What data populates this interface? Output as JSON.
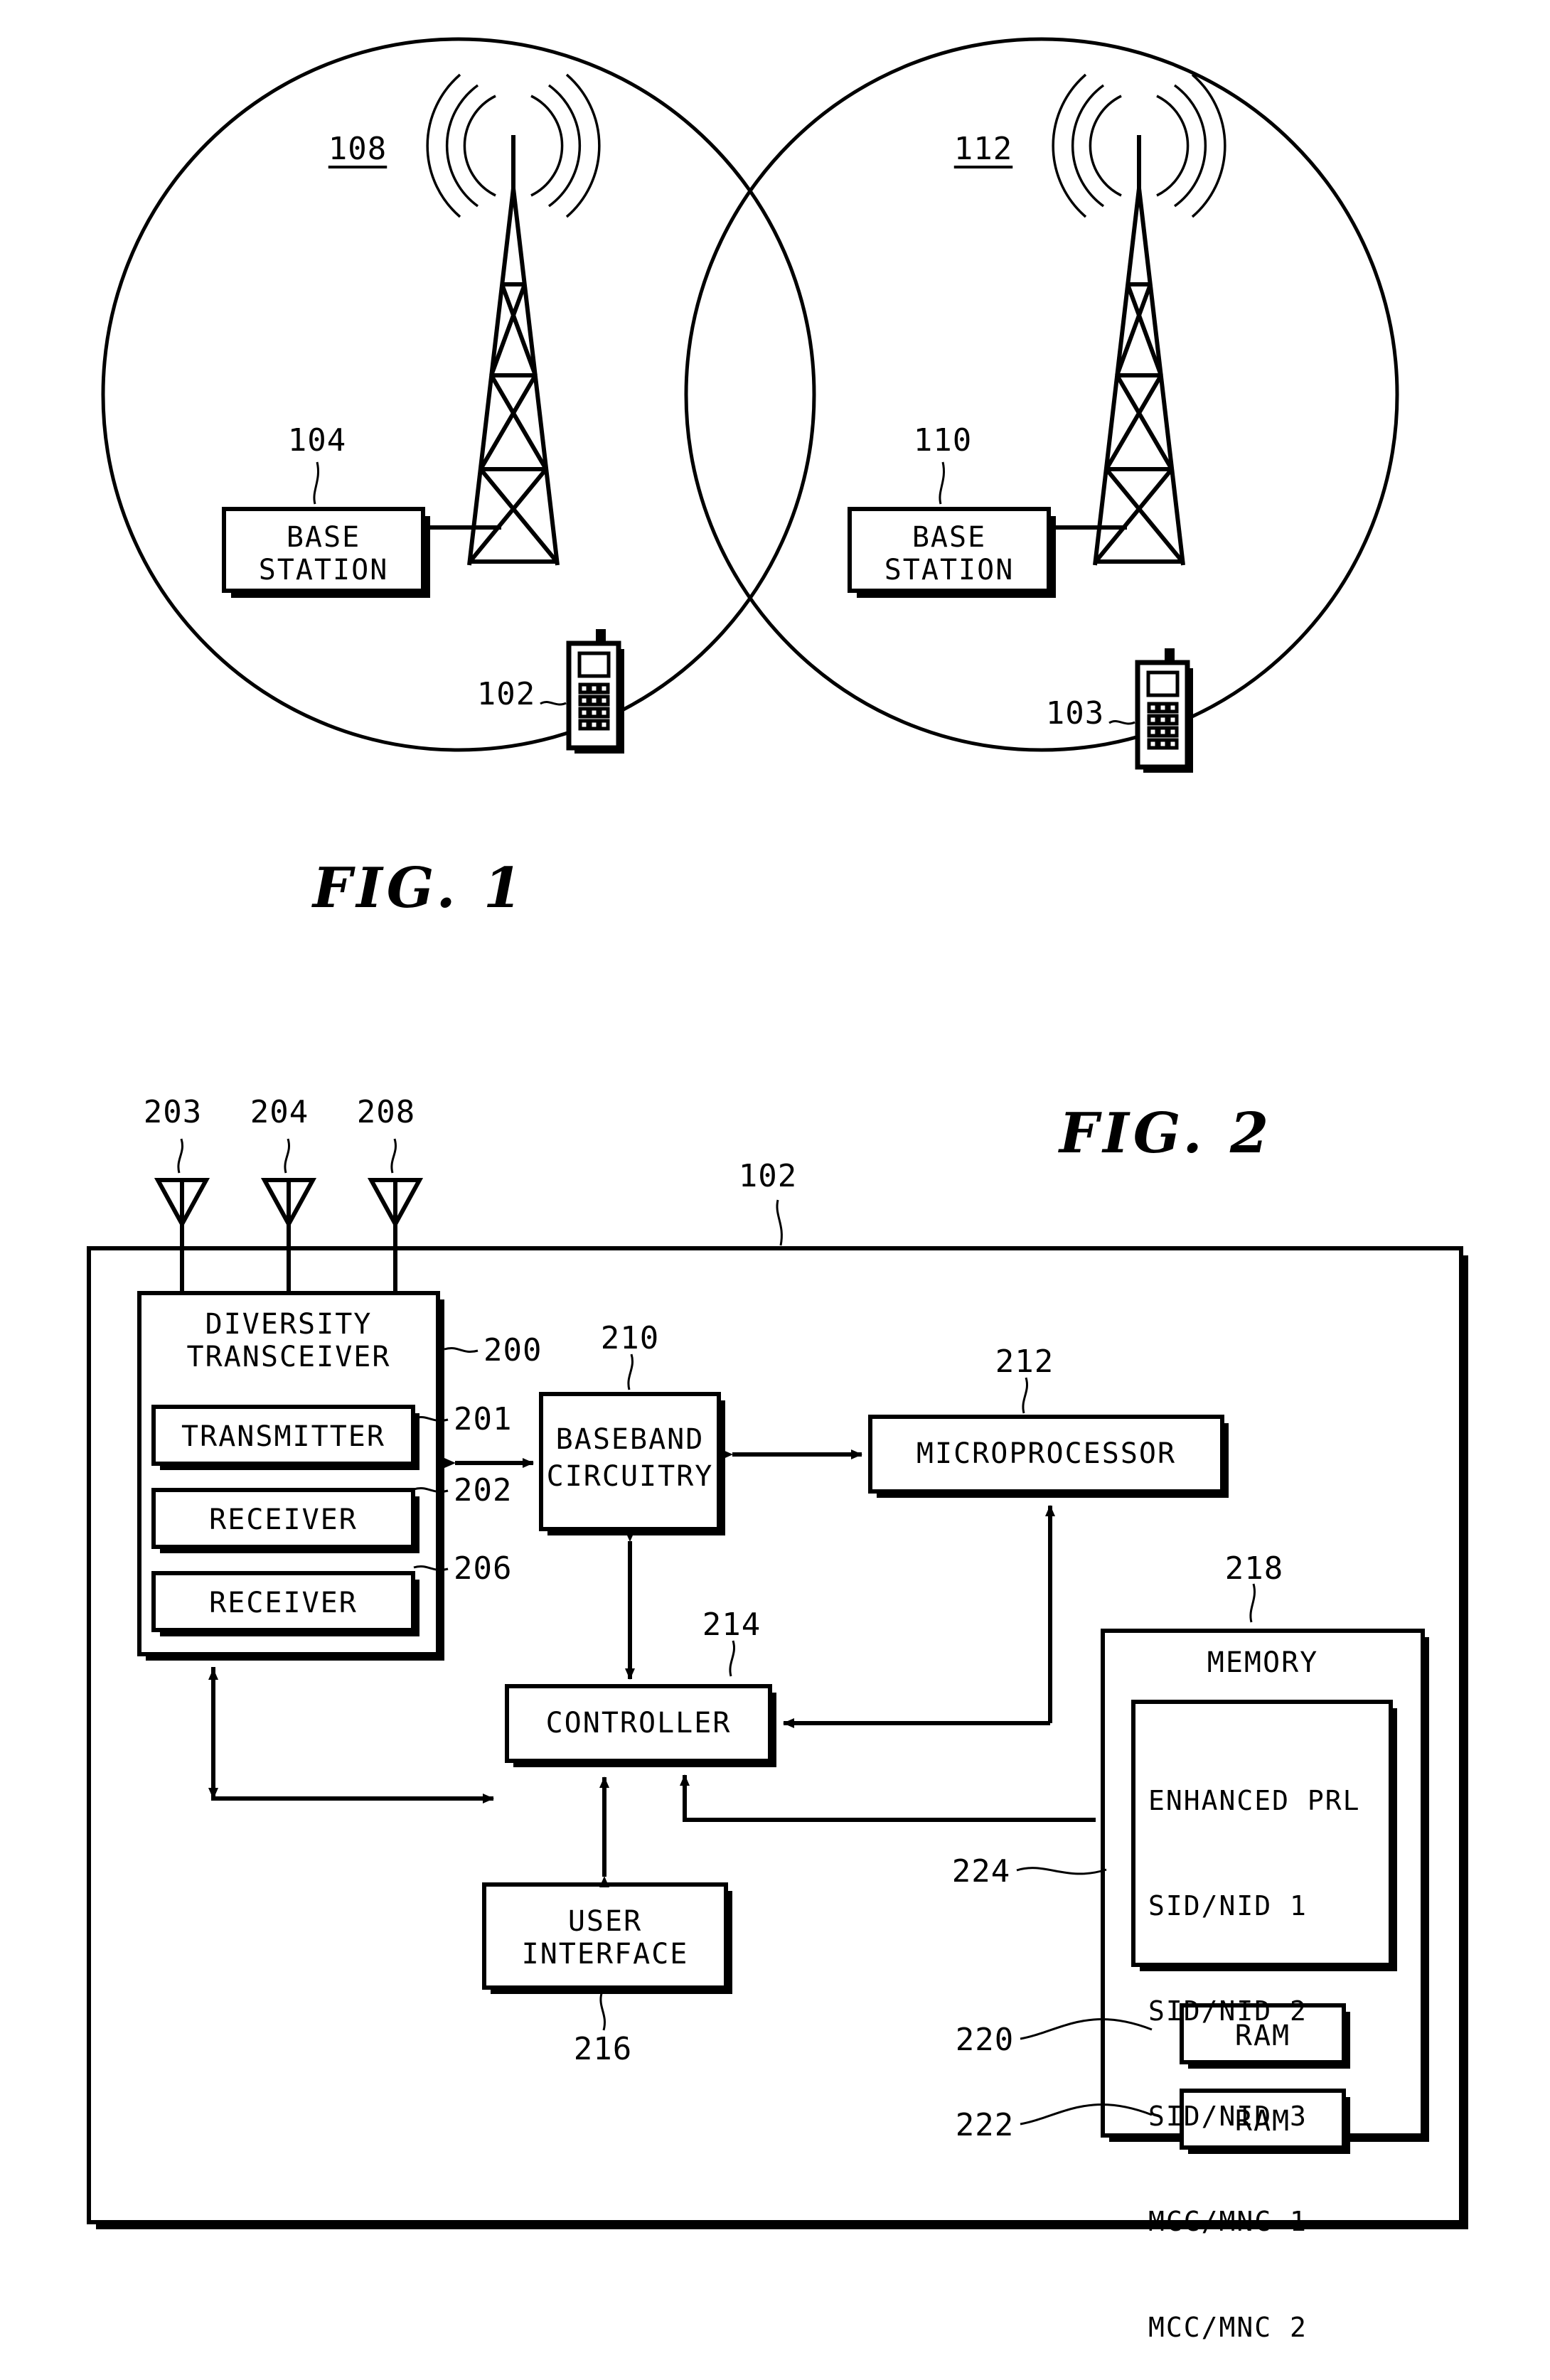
{
  "figures": [
    {
      "id": "fig1",
      "caption": "FIG. 1",
      "cells": [
        {
          "ref": "108",
          "base_station_ref": "104",
          "base_station_label": "BASE\nSTATION",
          "mobile_ref": "102"
        },
        {
          "ref": "112",
          "base_station_ref": "110",
          "base_station_label": "BASE\nSTATION",
          "mobile_ref": "103"
        }
      ]
    },
    {
      "id": "fig2",
      "caption": "FIG. 2",
      "device_ref": "102",
      "antennas": [
        {
          "ref": "203"
        },
        {
          "ref": "204"
        },
        {
          "ref": "208"
        }
      ],
      "blocks": [
        {
          "key": "transceiver",
          "ref": "200",
          "label": "DIVERSITY\nTRANSCEIVER"
        },
        {
          "key": "transmitter",
          "ref": "201",
          "label": "TRANSMITTER"
        },
        {
          "key": "receiver1",
          "ref": "202",
          "label": "RECEIVER"
        },
        {
          "key": "receiver2",
          "ref": "206",
          "label": "RECEIVER"
        },
        {
          "key": "baseband",
          "ref": "210",
          "label": "BASEBAND\nCIRCUITRY"
        },
        {
          "key": "microprocessor",
          "ref": "212",
          "label": "MICROPROCESSOR"
        },
        {
          "key": "controller",
          "ref": "214",
          "label": "CONTROLLER"
        },
        {
          "key": "user_interface",
          "ref": "216",
          "label": "USER\nINTERFACE"
        },
        {
          "key": "memory",
          "ref": "218",
          "label": "MEMORY"
        },
        {
          "key": "prl",
          "ref": "224",
          "label": "ENHANCED PRL"
        },
        {
          "key": "ram1",
          "ref": "220",
          "label": "RAM"
        },
        {
          "key": "ram2",
          "ref": "222",
          "label": "RAM"
        }
      ],
      "prl_entries": [
        "ENHANCED PRL",
        "SID/NID 1",
        "SID/NID 2",
        "SID/NID 3",
        "MCC/MNC 1",
        "MCC/MNC 2"
      ]
    }
  ],
  "colors": {
    "stroke": "#000000",
    "background": "#ffffff"
  }
}
